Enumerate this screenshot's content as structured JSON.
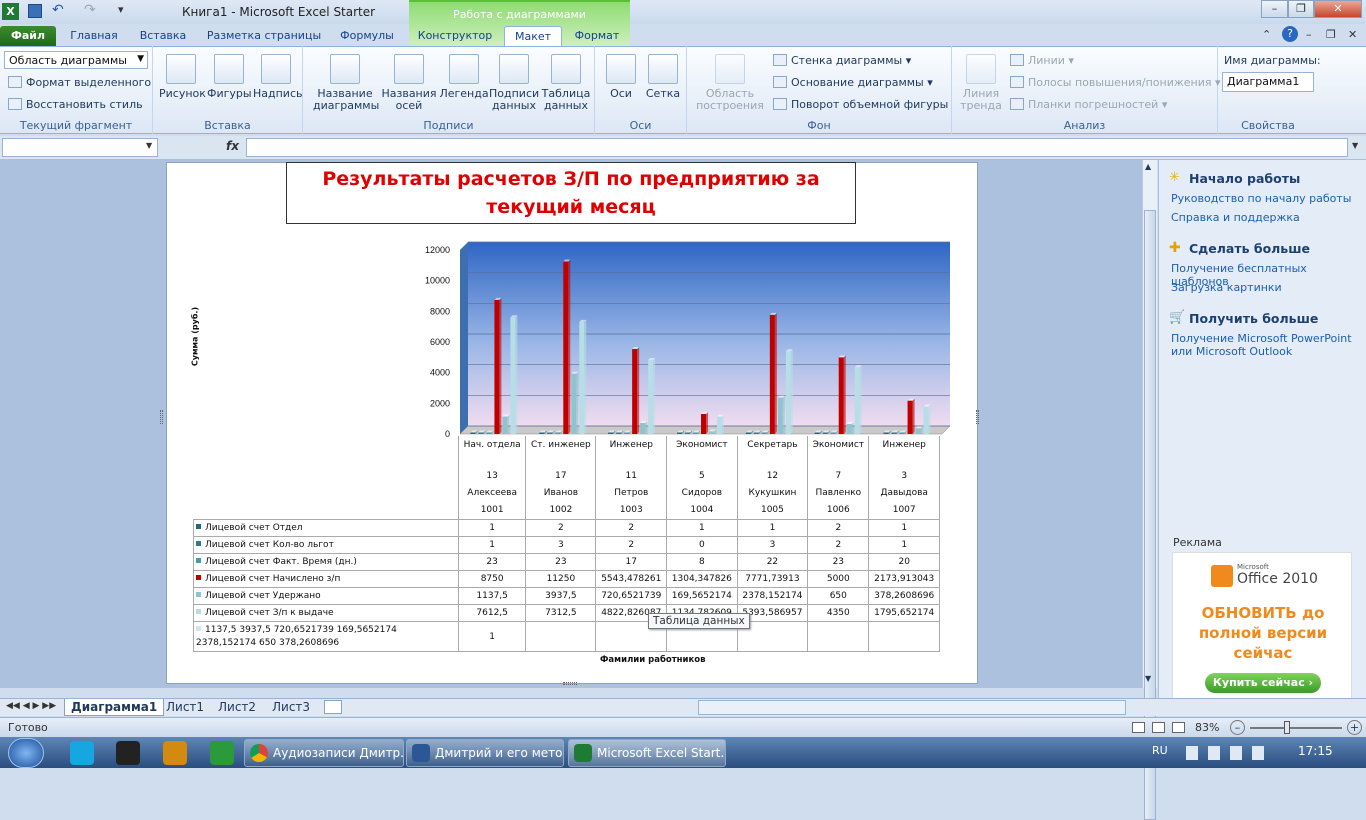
{
  "window": {
    "title": "Книга1  -  Microsoft Excel Starter",
    "context_group": "Работа с диаграммами"
  },
  "tabs": [
    "Файл",
    "Главная",
    "Вставка",
    "Разметка страницы",
    "Формулы",
    "Конструктор",
    "Макет",
    "Формат"
  ],
  "ribbon": {
    "current_fragment": {
      "selector": "Область диаграммы",
      "format": "Формат выделенного",
      "reset": "Восстановить стиль",
      "label": "Текущий фрагмент"
    },
    "insert": {
      "picture": "Рисунок",
      "shapes": "Фигуры",
      "textbox": "Надпись",
      "label": "Вставка"
    },
    "labels": {
      "chart_title": "Название\nдиаграммы",
      "axis_titles": "Названия\nосей",
      "legend": "Легенда",
      "data_labels": "Подписи\nданных",
      "data_table": "Таблица\nданных",
      "label": "Подписи"
    },
    "axes": {
      "axes": "Оси",
      "grid": "Сетка",
      "label": "Оси"
    },
    "background": {
      "plot_area": "Область\nпостроения",
      "wall": "Стенка диаграммы",
      "floor": "Основание диаграммы",
      "rotation": "Поворот объемной фигуры",
      "label": "Фон"
    },
    "analysis": {
      "trendline": "Линия\nтренда",
      "lines": "Линии",
      "updown": "Полосы повышения/понижения",
      "error": "Планки погрешностей",
      "label": "Анализ"
    },
    "properties": {
      "name_label": "Имя диаграммы:",
      "name_value": "Диаграмма1",
      "label": "Свойства"
    }
  },
  "formula": {
    "fx": "fx",
    "name_box": "",
    "value": ""
  },
  "chart_data": {
    "type": "bar",
    "title": "Результаты расчетов З/П по предприятию за текущий месяц",
    "ylabel": "Сумма (руб.)",
    "xlabel": "Фамилии работников",
    "ylim": [
      0,
      12000
    ],
    "yticks": [
      "0",
      "2000",
      "4000",
      "6000",
      "8000",
      "10000",
      "12000"
    ],
    "categories": [
      [
        "Нач. отдела",
        "13",
        "Алексеева",
        "1001"
      ],
      [
        "Ст. инженер",
        "17",
        "Иванов",
        "1002"
      ],
      [
        "Инженер",
        "11",
        "Петров",
        "1003"
      ],
      [
        "Экономист",
        "5",
        "Сидоров",
        "1004"
      ],
      [
        "Секретарь",
        "12",
        "Кукушкин",
        "1005"
      ],
      [
        "Экономист",
        "7",
        "Павленко",
        "1006"
      ],
      [
        "Инженер",
        "3",
        "Давыдова",
        "1007"
      ]
    ],
    "series": [
      {
        "name": "Лицевой счет Отдел",
        "color": "#1f6b7a",
        "values": [
          1,
          2,
          2,
          1,
          1,
          2,
          1
        ],
        "cells": [
          "1",
          "2",
          "2",
          "1",
          "1",
          "2",
          "1"
        ]
      },
      {
        "name": "Лицевой счет Кол-во льгот",
        "color": "#2e7d8c",
        "values": [
          1,
          3,
          2,
          0,
          3,
          2,
          1
        ],
        "cells": [
          "1",
          "3",
          "2",
          "0",
          "3",
          "2",
          "1"
        ]
      },
      {
        "name": "Лицевой счет Факт. Время (дн.)",
        "color": "#4a9aa8",
        "values": [
          23,
          23,
          17,
          8,
          22,
          23,
          20
        ],
        "cells": [
          "23",
          "23",
          "17",
          "8",
          "22",
          "23",
          "20"
        ]
      },
      {
        "name": "Лицевой счет Начислено з/п",
        "color": "#c00000",
        "values": [
          8750,
          11250,
          5543.478261,
          1304.347826,
          7771.73913,
          5000,
          2173.913043
        ],
        "cells": [
          "8750",
          "11250",
          "5543,478261",
          "1304,347826",
          "7771,73913",
          "5000",
          "2173,913043"
        ]
      },
      {
        "name": "Лицевой счет Удержано",
        "color": "#8fc3cf",
        "values": [
          1137.5,
          3937.5,
          720.6521739,
          169.5652174,
          2378.152174,
          650,
          378.2608696
        ],
        "cells": [
          "1137,5",
          "3937,5",
          "720,6521739",
          "169,5652174",
          "2378,152174",
          "650",
          "378,2608696"
        ]
      },
      {
        "name": "Лицевой счет З/п к выдаче",
        "color": "#b7dde6",
        "values": [
          7612.5,
          7312.5,
          4822.826087,
          1134.782609,
          5393.586957,
          4350,
          1795.652174
        ],
        "cells": [
          "7612,5",
          "7312,5",
          "4822,826087",
          "1134,782609",
          "5393,586957",
          "4350",
          "1795,652174"
        ]
      },
      {
        "name": "1137,5 3937,5 720,6521739 169,5652174 2378,152174 650 378,2608696",
        "color": "#cfe6ec",
        "values": [
          1,
          0,
          0,
          0,
          0,
          0,
          0
        ],
        "cells": [
          "1",
          "",
          "",
          "",
          "",
          "",
          ""
        ]
      }
    ]
  },
  "tooltip": "Таблица данных",
  "taskpane": {
    "h1": "Начало работы",
    "l1": "Руководство по началу работы",
    "l2": "Справка и поддержка",
    "h2": "Сделать больше",
    "l3": "Получение бесплатных шаблонов",
    "l4": "Загрузка картинки",
    "h3": "Получить больше",
    "l5": "Получение Microsoft PowerPoint или Microsoft Outlook",
    "ad_label": "Реклама",
    "ad_brand": "Office 2010",
    "ad_ms": "Microsoft",
    "ad_text": "ОБНОВИТЬ до полной версии сейчас",
    "ad_button": "Купить сейчас ›"
  },
  "sheets": [
    "Диаграмма1",
    "Лист1",
    "Лист2",
    "Лист3"
  ],
  "status": {
    "ready": "Готово",
    "zoom": "83%"
  },
  "taskbar": {
    "items": [
      "Аудиозаписи Дмитр...",
      "Дмитрий и его мето...",
      "Microsoft Excel Start..."
    ],
    "lang": "RU",
    "time": "17:15"
  }
}
